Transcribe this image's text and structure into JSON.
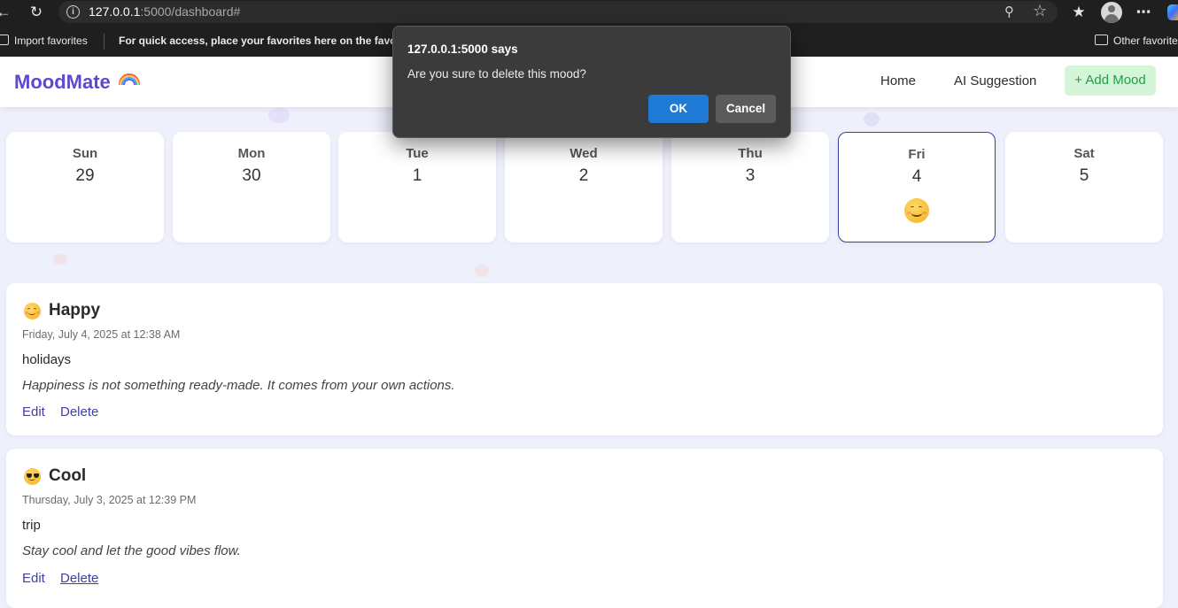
{
  "browser": {
    "url_host": "127.0.0.1",
    "url_rest": ":5000/dashboard#",
    "bookmarks": {
      "import_label": "Import favorites",
      "hint": "For quick access, place your favorites here on the favorites bar.",
      "other_label": "Other favorites"
    }
  },
  "header": {
    "logo": "MoodMate",
    "nav": {
      "home": "Home",
      "ai": "AI Suggestion",
      "add": "+ Add Mood"
    }
  },
  "week": [
    {
      "day": "Sun",
      "num": "29"
    },
    {
      "day": "Mon",
      "num": "30"
    },
    {
      "day": "Tue",
      "num": "1"
    },
    {
      "day": "Wed",
      "num": "2"
    },
    {
      "day": "Thu",
      "num": "3"
    },
    {
      "day": "Fri",
      "num": "4",
      "selected": true,
      "mood_icon": "smiling-face-icon"
    },
    {
      "day": "Sat",
      "num": "5"
    }
  ],
  "moods": [
    {
      "title": "Happy",
      "icon": "smiling-face-icon",
      "date": "Friday, July 4, 2025 at 12:38 AM",
      "note": "holidays",
      "quote": "Happiness is not something ready-made. It comes from your own actions.",
      "edit": "Edit",
      "delete": "Delete"
    },
    {
      "title": "Cool",
      "icon": "sunglasses-face-icon",
      "date": "Thursday, July 3, 2025 at 12:39 PM",
      "note": "trip",
      "quote": "Stay cool and let the good vibes flow.",
      "edit": "Edit",
      "delete": "Delete"
    }
  ],
  "dialog": {
    "title": "127.0.0.1:5000 says",
    "message": "Are you sure to delete this mood?",
    "ok": "OK",
    "cancel": "Cancel"
  },
  "colors": {
    "brand": "#5b4ad0",
    "link": "#3f3ea8",
    "add_button_bg": "#d5f5d9",
    "dialog_ok": "#1f7ad6"
  }
}
